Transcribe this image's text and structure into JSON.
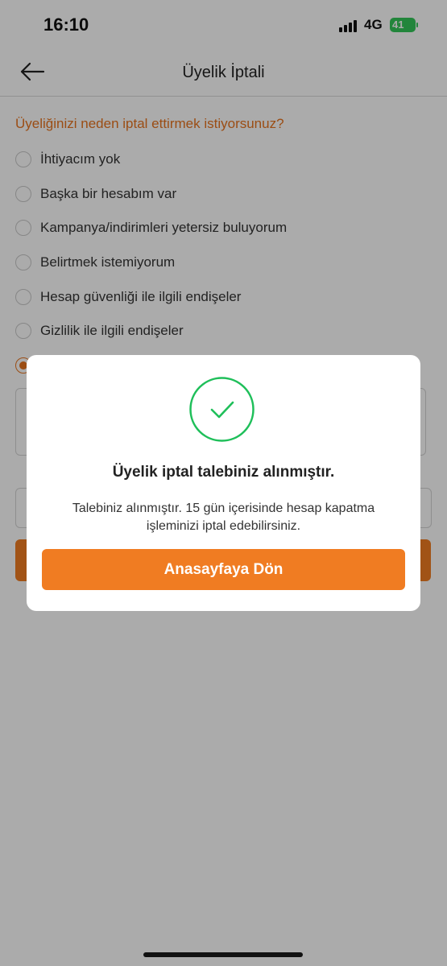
{
  "status_bar": {
    "time": "16:10",
    "network": "4G",
    "battery": "41"
  },
  "header": {
    "title": "Üyelik İptali"
  },
  "form": {
    "question": "Üyeliğinizi neden iptal ettirmek istiyorsunuz?",
    "options": [
      {
        "label": "İhtiyacım yok",
        "selected": false
      },
      {
        "label": "Başka bir hesabım var",
        "selected": false
      },
      {
        "label": "Kampanya/indirimleri yetersiz buluyorum",
        "selected": false
      },
      {
        "label": "Belirtmek istemiyorum",
        "selected": false
      },
      {
        "label": "Hesap güvenliği ile ilgili endişeler",
        "selected": false
      },
      {
        "label": "Gizlilik ile ilgili endişeler",
        "selected": false
      },
      {
        "label": "",
        "selected": true
      }
    ]
  },
  "modal": {
    "title": "Üyelik iptal talebiniz alınmıştır.",
    "message": "Talebiniz alınmıştır. 15 gün içerisinde hesap kapatma işleminizi iptal edebilirsiniz.",
    "button_label": "Anasayfaya Dön"
  },
  "colors": {
    "accent": "#f07c22",
    "success": "#1fbf5a",
    "question": "#e8741f"
  }
}
